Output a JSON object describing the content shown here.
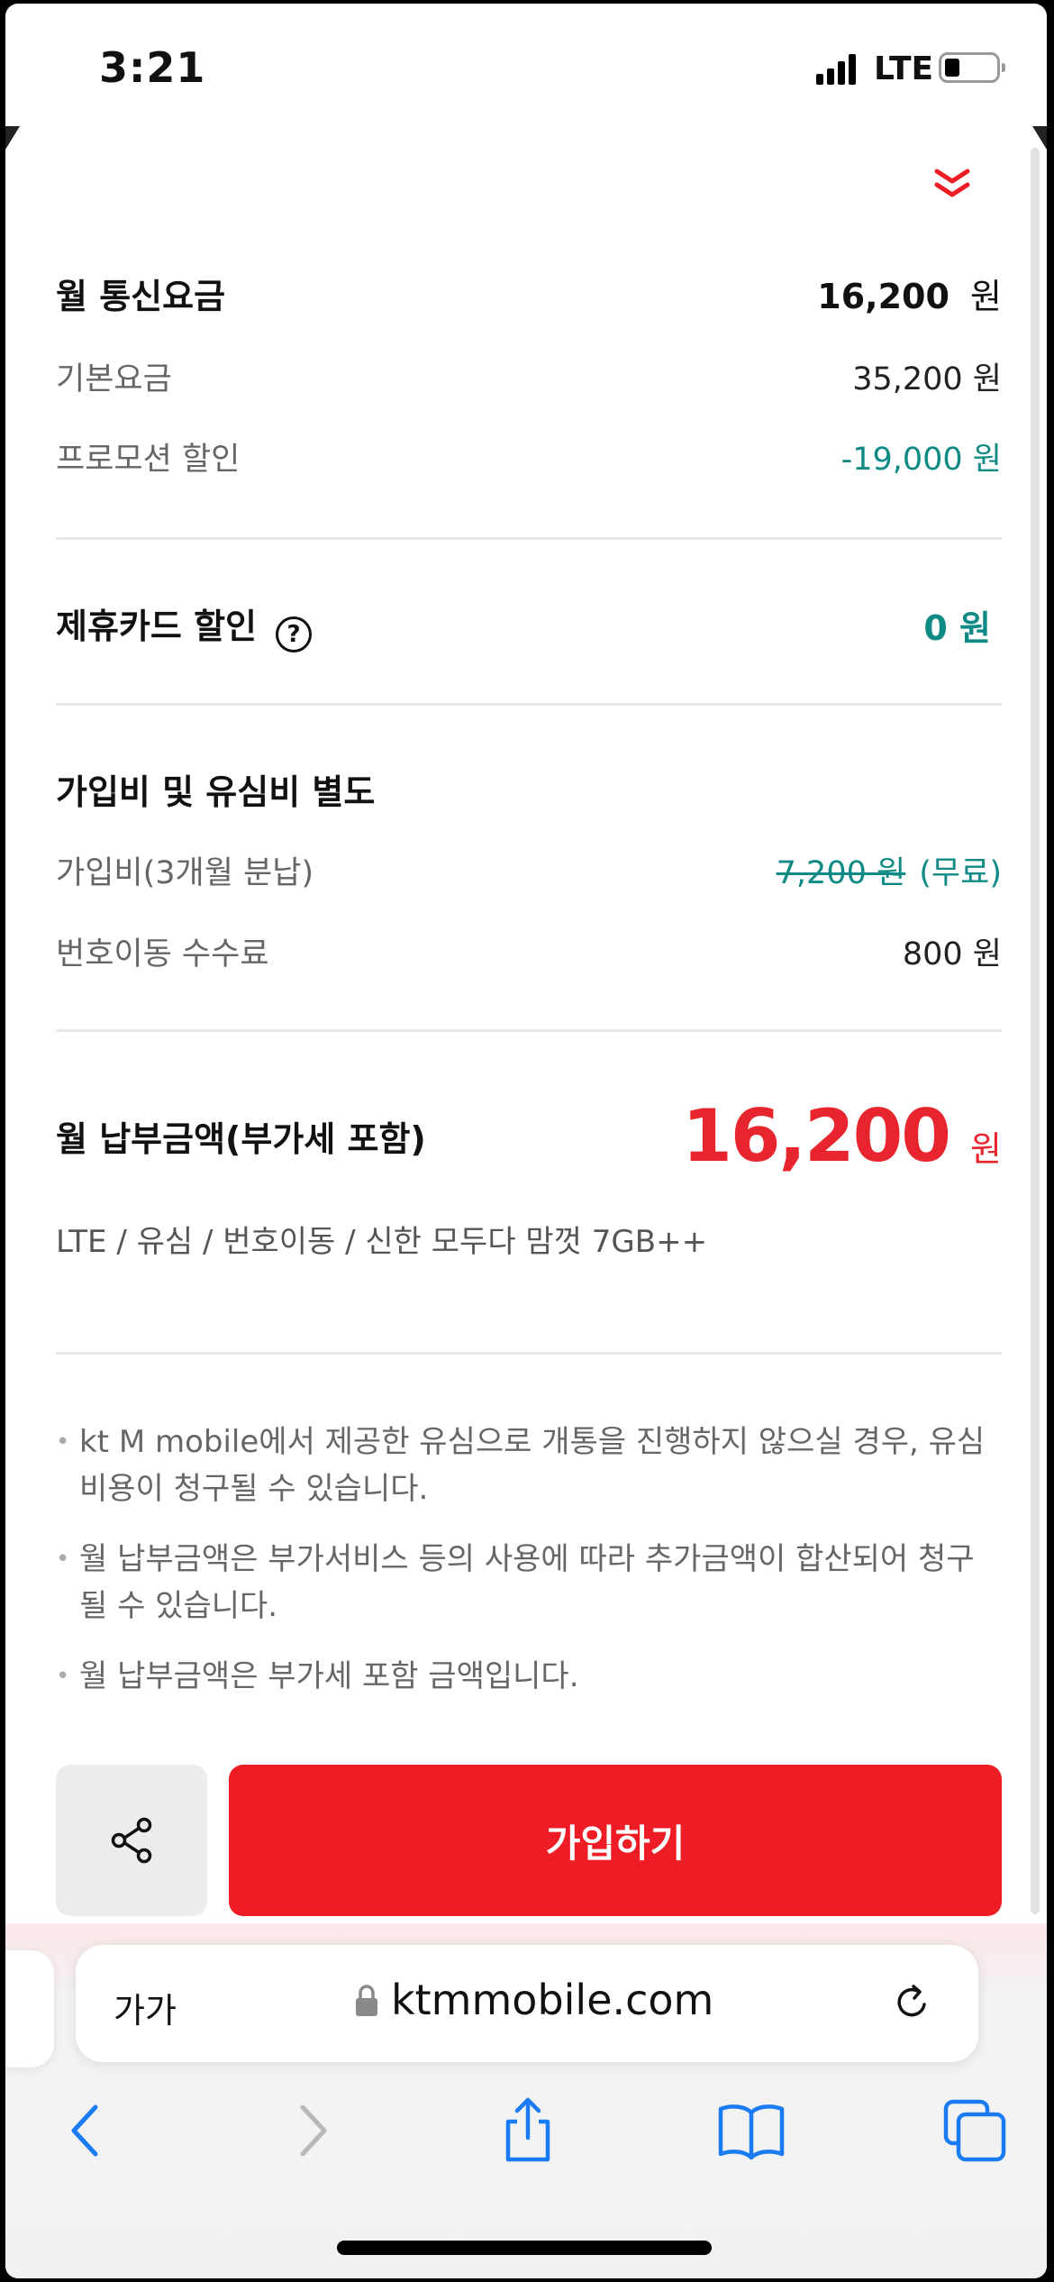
{
  "status_bar": {
    "time": "3:21",
    "network": "LTE"
  },
  "breakdown": {
    "monthly_fee": {
      "label": "월 통신요금",
      "value": "16,200",
      "unit": "원"
    },
    "base_fee": {
      "label": "기본요금",
      "value": "35,200 원"
    },
    "promo_discount": {
      "label": "프로모션 할인",
      "value": "-19,000 원"
    }
  },
  "card_discount": {
    "label": "제휴카드 할인",
    "help_glyph": "?",
    "value": "0 원"
  },
  "extra_fees": {
    "title": "가입비 및 유심비 별도",
    "signup": {
      "label": "가입비(3개월 분납)",
      "original": "7,200 원",
      "free_text": "(무료)"
    },
    "port": {
      "label": "번호이동 수수료",
      "value": "800 원"
    }
  },
  "total": {
    "label": "월 납부금액(부가세 포함)",
    "amount": "16,200",
    "unit": "원"
  },
  "summary": "LTE / 유심 / 번호이동 / 신한 모두다 맘껏 7GB++",
  "notes": [
    "kt M mobile에서 제공한 유심으로 개통을 진행하지 않으실 경우, 유심비용이 청구될 수 있습니다.",
    "월 납부금액은 부가서비스 등의 사용에 따라 추가금액이 합산되어 청구 될 수 있습니다.",
    "월 납부금액은 부가세 포함 금액입니다."
  ],
  "actions": {
    "join_label": "가입하기"
  },
  "browser": {
    "text_size_label": "가가",
    "url": "ktmmobile.com"
  },
  "colors": {
    "accent_red": "#ee1c25",
    "teal": "#0f8a84",
    "ios_blue": "#1a7cf5"
  },
  "icons": [
    "chevron-double-down-icon",
    "help-icon",
    "share-icon",
    "lock-icon",
    "reload-icon",
    "back-icon",
    "forward-icon",
    "share-sheet-icon",
    "bookmarks-icon",
    "tabs-icon"
  ]
}
